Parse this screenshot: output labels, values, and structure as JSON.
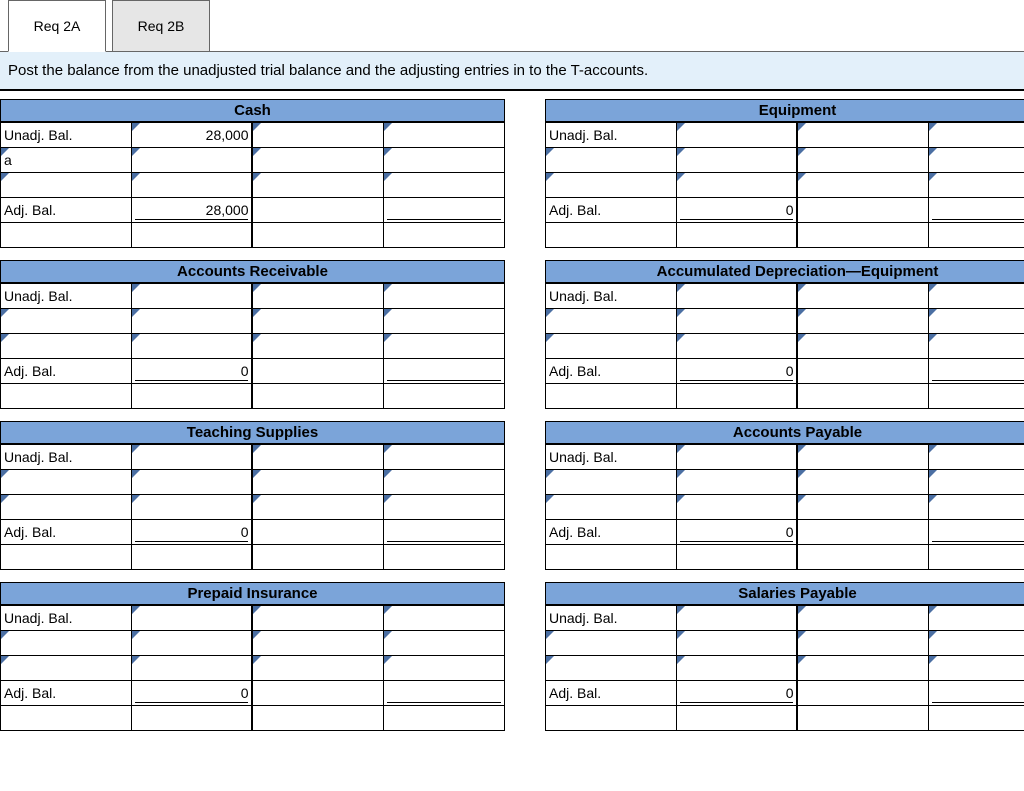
{
  "tabs": {
    "a": "Req 2A",
    "b": "Req 2B"
  },
  "instruction": "Post the balance from the unadjusted trial balance and the adjusting entries in to the T-accounts.",
  "labels": {
    "unadj": "Unadj. Bal.",
    "adj": "Adj. Bal."
  },
  "left": [
    {
      "title": "Cash",
      "rows": [
        {
          "l1": "Unadj. Bal.",
          "a1": "28,000",
          "l2": "",
          "a2": ""
        },
        {
          "l1": "a",
          "a1": "",
          "l2": "",
          "a2": ""
        },
        {
          "l1": "",
          "a1": "",
          "l2": "",
          "a2": ""
        }
      ],
      "adj": {
        "l1": "Adj. Bal.",
        "a1": "28,000",
        "l2": "",
        "a2": ""
      }
    },
    {
      "title": "Accounts Receivable",
      "rows": [
        {
          "l1": "Unadj. Bal.",
          "a1": "",
          "l2": "",
          "a2": ""
        },
        {
          "l1": "",
          "a1": "",
          "l2": "",
          "a2": ""
        },
        {
          "l1": "",
          "a1": "",
          "l2": "",
          "a2": ""
        }
      ],
      "adj": {
        "l1": "Adj. Bal.",
        "a1": "0",
        "l2": "",
        "a2": ""
      }
    },
    {
      "title": "Teaching Supplies",
      "rows": [
        {
          "l1": "Unadj. Bal.",
          "a1": "",
          "l2": "",
          "a2": ""
        },
        {
          "l1": "",
          "a1": "",
          "l2": "",
          "a2": ""
        },
        {
          "l1": "",
          "a1": "",
          "l2": "",
          "a2": ""
        }
      ],
      "adj": {
        "l1": "Adj. Bal.",
        "a1": "0",
        "l2": "",
        "a2": ""
      }
    },
    {
      "title": "Prepaid Insurance",
      "rows": [
        {
          "l1": "Unadj. Bal.",
          "a1": "",
          "l2": "",
          "a2": ""
        },
        {
          "l1": "",
          "a1": "",
          "l2": "",
          "a2": ""
        },
        {
          "l1": "",
          "a1": "",
          "l2": "",
          "a2": ""
        }
      ],
      "adj": {
        "l1": "Adj. Bal.",
        "a1": "0",
        "l2": "",
        "a2": ""
      }
    }
  ],
  "right": [
    {
      "title": "Equipment",
      "rows": [
        {
          "l1": "Unadj. Bal.",
          "a1": "",
          "l2": "",
          "a2": ""
        },
        {
          "l1": "",
          "a1": "",
          "l2": "",
          "a2": ""
        },
        {
          "l1": "",
          "a1": "",
          "l2": "",
          "a2": ""
        }
      ],
      "adj": {
        "l1": "Adj. Bal.",
        "a1": "0",
        "l2": "",
        "a2": ""
      }
    },
    {
      "title": "Accumulated Depreciation—Equipment",
      "rows": [
        {
          "l1": "Unadj. Bal.",
          "a1": "",
          "l2": "",
          "a2": ""
        },
        {
          "l1": "",
          "a1": "",
          "l2": "",
          "a2": ""
        },
        {
          "l1": "",
          "a1": "",
          "l2": "",
          "a2": ""
        }
      ],
      "adj": {
        "l1": "Adj. Bal.",
        "a1": "0",
        "l2": "",
        "a2": ""
      }
    },
    {
      "title": "Accounts Payable",
      "rows": [
        {
          "l1": "Unadj. Bal.",
          "a1": "",
          "l2": "",
          "a2": ""
        },
        {
          "l1": "",
          "a1": "",
          "l2": "",
          "a2": ""
        },
        {
          "l1": "",
          "a1": "",
          "l2": "",
          "a2": ""
        }
      ],
      "adj": {
        "l1": "Adj. Bal.",
        "a1": "0",
        "l2": "",
        "a2": ""
      }
    },
    {
      "title": "Salaries Payable",
      "rows": [
        {
          "l1": "Unadj. Bal.",
          "a1": "",
          "l2": "",
          "a2": ""
        },
        {
          "l1": "",
          "a1": "",
          "l2": "",
          "a2": ""
        },
        {
          "l1": "",
          "a1": "",
          "l2": "",
          "a2": ""
        }
      ],
      "adj": {
        "l1": "Adj. Bal.",
        "a1": "0",
        "l2": "",
        "a2": ""
      }
    }
  ]
}
